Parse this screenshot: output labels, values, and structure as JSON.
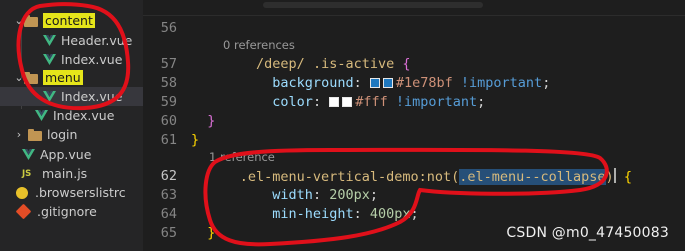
{
  "explorer": {
    "items": [
      {
        "label": "content",
        "kind": "folder",
        "open": true,
        "highlight": true
      },
      {
        "label": "Header.vue",
        "kind": "vue"
      },
      {
        "label": "Index.vue",
        "kind": "vue"
      },
      {
        "label": "menu",
        "kind": "folder",
        "open": true,
        "highlight": true
      },
      {
        "label": "Index.vue",
        "kind": "vue",
        "selected": true
      },
      {
        "label": "Index.vue",
        "kind": "vue"
      },
      {
        "label": "login",
        "kind": "folder",
        "open": false
      },
      {
        "label": "App.vue",
        "kind": "vue"
      },
      {
        "label": "main.js",
        "kind": "js",
        "icon_text": "JS"
      },
      {
        "label": ".browserslistrc",
        "kind": "browserslist"
      },
      {
        "label": ".gitignore",
        "kind": "git"
      }
    ]
  },
  "editor": {
    "line_numbers": [
      "56",
      "57",
      "58",
      "59",
      "60",
      "61",
      "62",
      "63",
      "64",
      "65"
    ],
    "codelens": [
      "0 references",
      "1 reference"
    ],
    "code": {
      "l57_selector": "/deep/ .is-active",
      "l57_open": "{",
      "l58_prop": "background",
      "l58_colon": ":",
      "l58_value": "#1e78bf",
      "l58_important": "!important",
      "l58_semi": ";",
      "l59_prop": "color",
      "l59_colon": ":",
      "l59_value": "#fff",
      "l59_important": "!important",
      "l59_semi": ";",
      "l60_close": "}",
      "l61_close": "}",
      "l62_selector": ".el-menu-vertical-demo:not(",
      "l62_selected": ".el-menu--collapse",
      "l62_paren": ")",
      "l62_open": "{",
      "l63_prop": "width",
      "l63_colon": ":",
      "l63_value": "200px",
      "l63_semi": ";",
      "l64_prop": "min-height",
      "l64_colon": ":",
      "l64_value": "400px",
      "l64_semi": ";",
      "l65_close": "}"
    },
    "colors": {
      "background_swatch": "#1e78bf",
      "color_swatch": "#ffffff",
      "annotation": "#e0101a"
    }
  },
  "watermark": "CSDN @m0_47450083"
}
